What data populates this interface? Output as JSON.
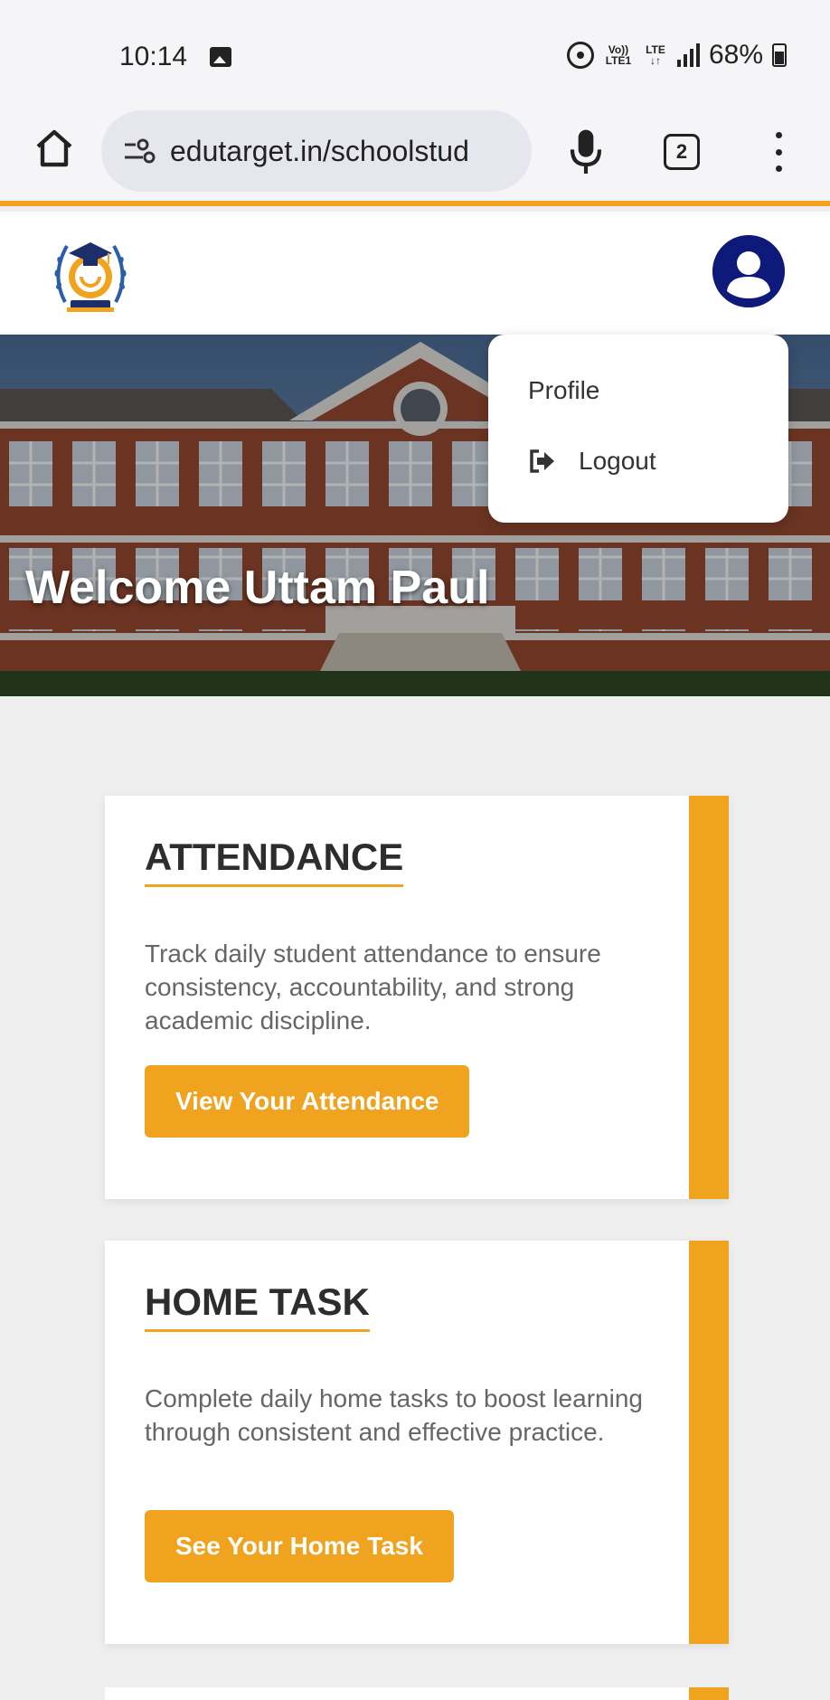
{
  "status_bar": {
    "time": "10:14",
    "volte": "Vo)) LTE1",
    "lte": "LTE ↓↑",
    "battery": "68%"
  },
  "browser": {
    "url": "edutarget.in/schoolstud",
    "tab_count": "2"
  },
  "header": {
    "logo_icon": "school-crest-logo",
    "avatar_icon": "user-avatar-icon"
  },
  "hero": {
    "welcome": "Welcome Uttam Paul"
  },
  "dropdown": {
    "profile": "Profile",
    "logout": "Logout"
  },
  "cards": [
    {
      "title": "ATTENDANCE",
      "description": "Track daily student attendance to ensure consistency, accountability, and strong academic discipline.",
      "button": "View Your Attendance"
    },
    {
      "title": "HOME TASK",
      "description": "Complete daily home tasks to boost learning through consistent and effective practice.",
      "button": "See Your Home Task"
    }
  ],
  "colors": {
    "accent": "#f0a31e",
    "avatar": "#0d1a7a"
  }
}
